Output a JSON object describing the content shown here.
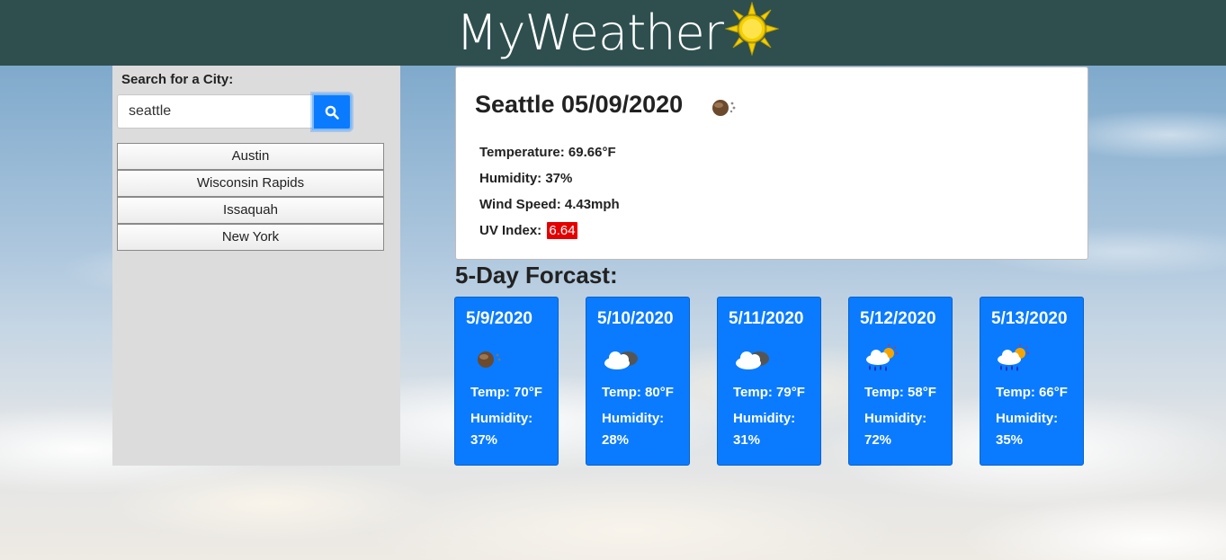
{
  "header": {
    "title": "MyWeather",
    "logo_icon": "sun-icon"
  },
  "sidebar": {
    "search_label": "Search for a City:",
    "search_value": "seattle",
    "search_icon": "search-icon",
    "cities": [
      "Austin",
      "Wisconsin Rapids",
      "Issaquah",
      "New York"
    ]
  },
  "current": {
    "title": "Seattle 05/09/2020",
    "icon": "haze-moon-icon",
    "temperature": "Temperature: 69.66°F",
    "humidity": "Humidity: 37%",
    "wind": "Wind Speed: 4.43mph",
    "uv_label": "UV Index:",
    "uv_value": "6.64",
    "uv_color": "#e50000"
  },
  "forecast": {
    "title": "5-Day Forcast:",
    "card_color": "#0a7bff",
    "humidity_label": "Humidity:",
    "days": [
      {
        "date": "5/9/2020",
        "icon": "haze-moon-icon",
        "temp": "Temp: 70°F",
        "humidity": "37%"
      },
      {
        "date": "5/10/2020",
        "icon": "cloudy-icon",
        "temp": "Temp: 80°F",
        "humidity": "28%"
      },
      {
        "date": "5/11/2020",
        "icon": "cloudy-icon",
        "temp": "Temp: 79°F",
        "humidity": "31%"
      },
      {
        "date": "5/12/2020",
        "icon": "rain-sun-icon",
        "temp": "Temp: 58°F",
        "humidity": "72%"
      },
      {
        "date": "5/13/2020",
        "icon": "rain-sun-icon",
        "temp": "Temp: 66°F",
        "humidity": "35%"
      }
    ]
  }
}
